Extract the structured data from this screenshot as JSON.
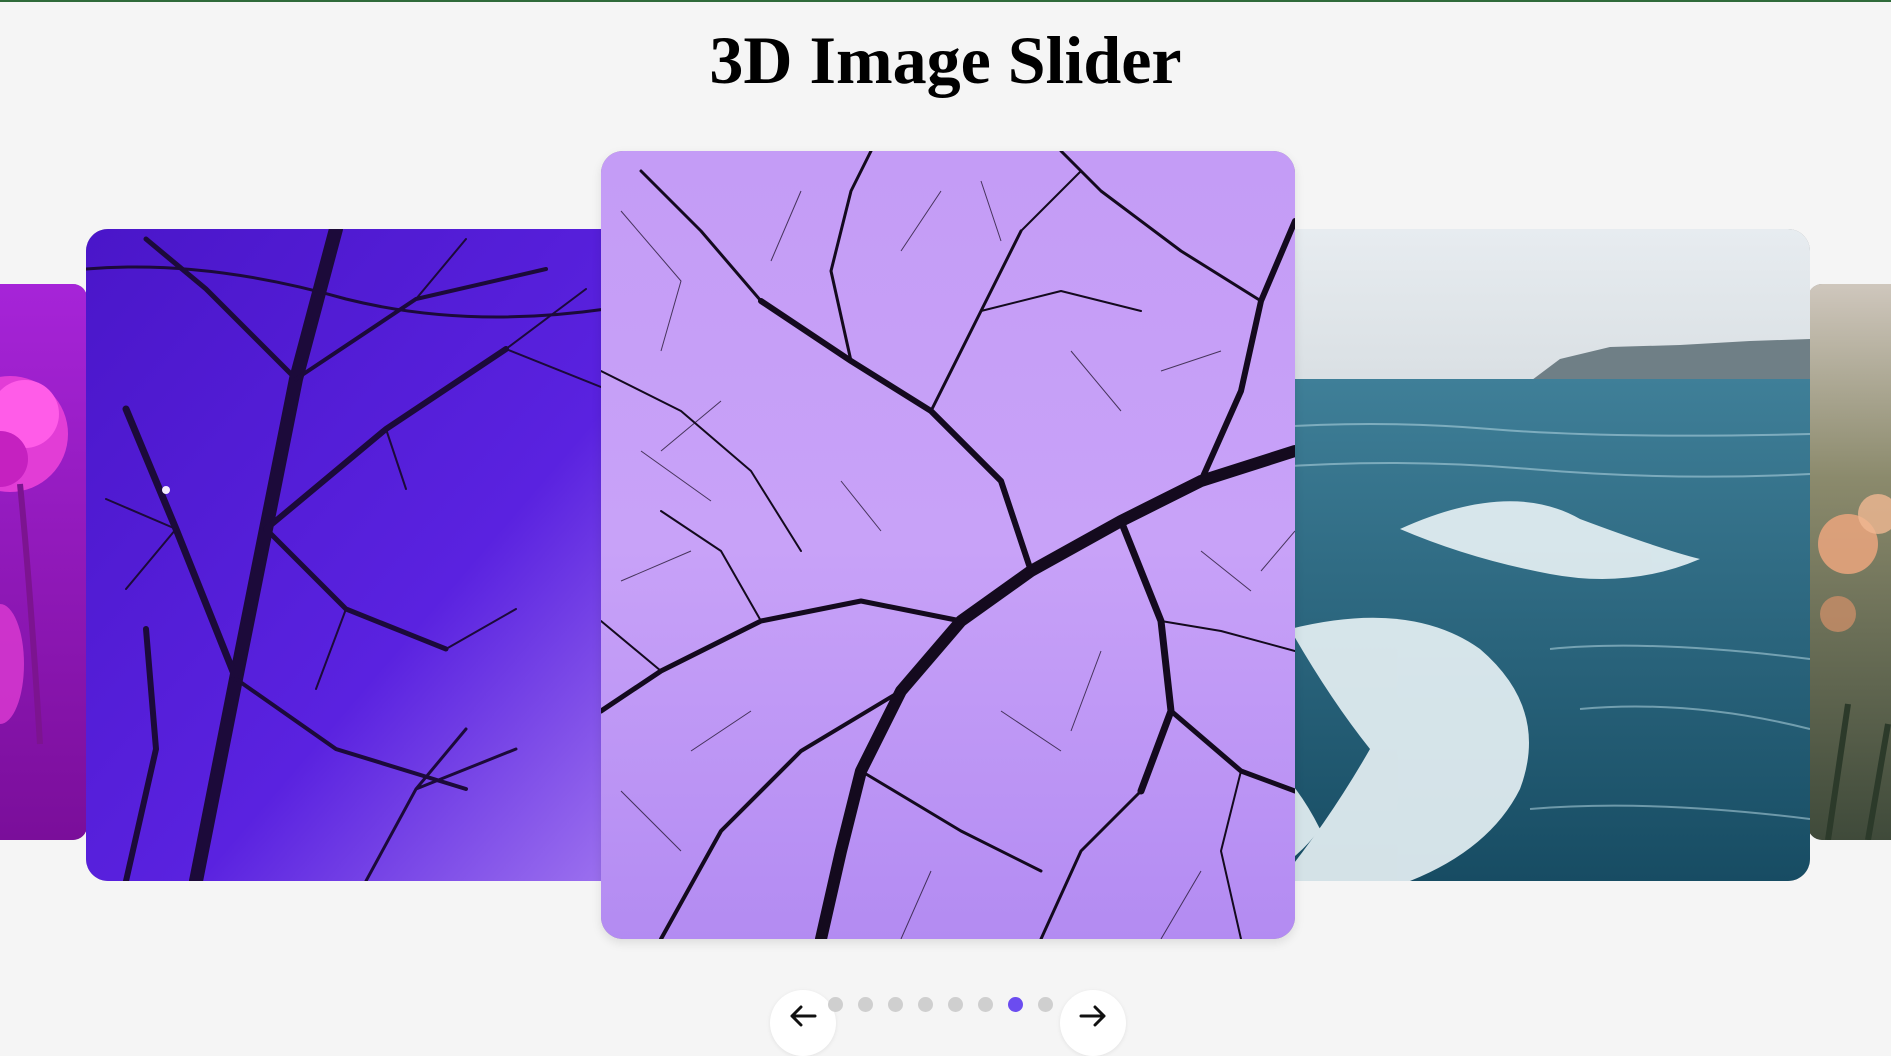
{
  "page": {
    "title": "3D Image Slider"
  },
  "slider": {
    "slides": [
      {
        "name": "pink-flower",
        "position": "far-left"
      },
      {
        "name": "purple-bare-trees-moon",
        "position": "left"
      },
      {
        "name": "lavender-sky-branches",
        "position": "center"
      },
      {
        "name": "ocean-waves",
        "position": "right"
      },
      {
        "name": "blurred-flowers",
        "position": "far-right"
      }
    ],
    "dots_count": 9,
    "active_dot_index": 6,
    "active_color": "#6b4cf0",
    "inactive_color": "#cfcfcf"
  },
  "controls": {
    "prev_icon": "arrow-left-icon",
    "next_icon": "arrow-right-icon"
  }
}
